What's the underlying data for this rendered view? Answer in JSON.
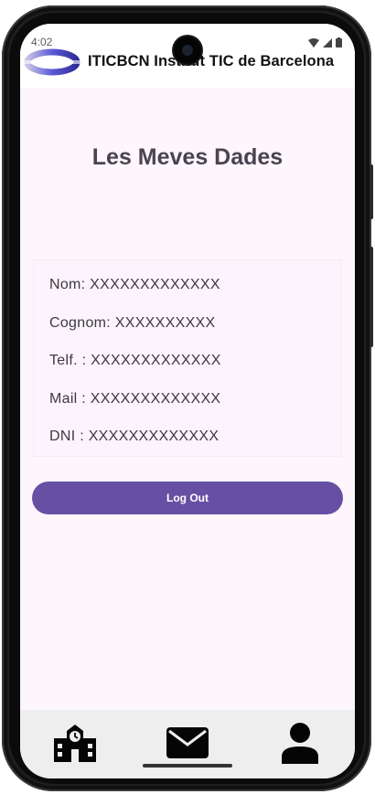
{
  "status_bar": {
    "time": "4:02"
  },
  "header": {
    "title": "ITICBCN Institut TIC de Barcelona",
    "logo_icon": "iticbcn-logo"
  },
  "page": {
    "title": "Les Meves Dades"
  },
  "profile": {
    "nom": "Nom: XXXXXXXXXXXXX",
    "cognom": "Cognom: XXXXXXXXXX",
    "telf": "Telf. : XXXXXXXXXXXXX",
    "mail": "Mail : XXXXXXXXXXXXX",
    "dni": "DNI : XXXXXXXXXXXXX"
  },
  "actions": {
    "logout_label": "Log Out"
  },
  "bottom_nav": {
    "items": [
      {
        "icon": "school-icon"
      },
      {
        "icon": "mail-icon"
      },
      {
        "icon": "person-icon"
      }
    ]
  },
  "colors": {
    "background": "#fdf6fd",
    "primary_button": "#6750a4",
    "title_text": "#4a4450",
    "nav_background": "#eeeeee"
  }
}
